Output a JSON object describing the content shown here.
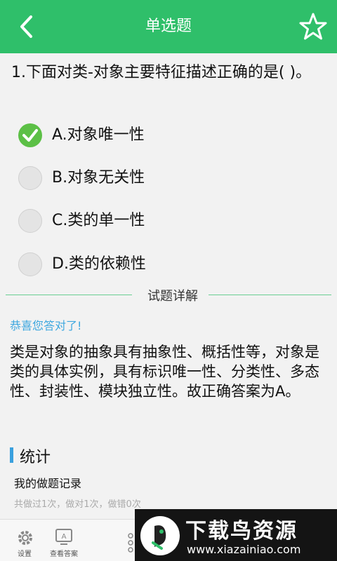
{
  "header": {
    "title": "单选题",
    "back_icon": "chevron-left-icon",
    "star_icon": "star-outline-icon",
    "color": "#2fbf6a"
  },
  "question": {
    "text": "1.下面对类-对象主要特征描述正确的是( )。"
  },
  "options": [
    {
      "label": "A.对象唯一性",
      "selected": true
    },
    {
      "label": "B.对象无关性",
      "selected": false
    },
    {
      "label": "C.类的单一性",
      "selected": false
    },
    {
      "label": "D.类的依赖性",
      "selected": false
    }
  ],
  "detail": {
    "divider_label": "试题详解",
    "congrats": "恭喜您答对了!",
    "analysis": "类是对象的抽象具有抽象性、概括性等，对象是类的具体实例，具有标识唯一性、分类性、多态性、封装性、模块独立性。故正确答案为A。"
  },
  "stats": {
    "heading": "统计",
    "record_title": "我的做题记录",
    "record_detail": "共做过1次，做对1次，做错0次"
  },
  "bottom_bar": {
    "settings_label": "设置",
    "answer_label": "查看答案"
  },
  "watermark": {
    "title": "下载鸟资源",
    "url": "www.xiazainiao.com"
  }
}
